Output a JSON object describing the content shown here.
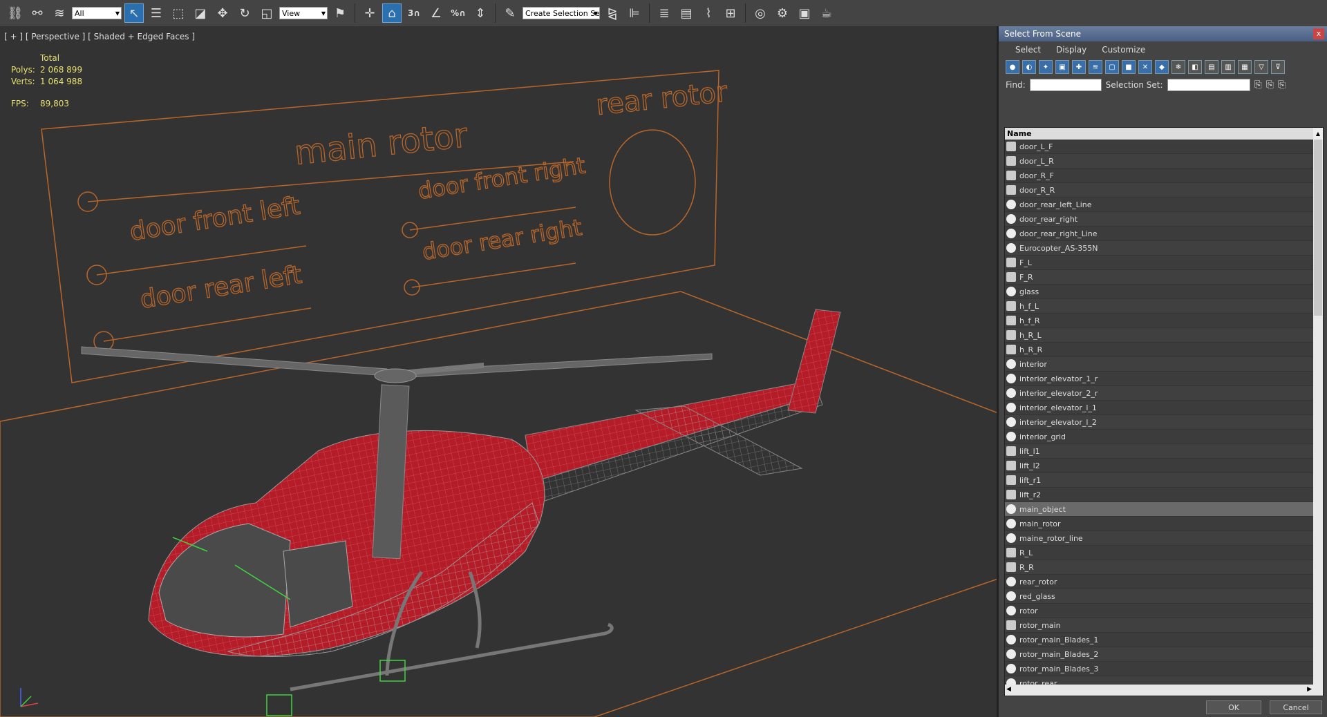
{
  "toolbar": {
    "filter_value": "All",
    "refcoord_value": "View",
    "named_selection_value": "Create Selection Se",
    "snap_label": "3",
    "percent_label": "%"
  },
  "viewport": {
    "label": "[ + ] [ Perspective ] [ Shaded + Edged Faces ]",
    "stats": {
      "total_label": "Total",
      "polys_label": "Polys:",
      "polys_value": "2 068 899",
      "verts_label": "Verts:",
      "verts_value": "1 064 988",
      "fps_label": "FPS:",
      "fps_value": "89,803"
    },
    "scene_texts": {
      "main_rotor": "main rotor",
      "rear_rotor": "rear rotor",
      "door_front_left": "door front left",
      "door_front_right": "door front right",
      "door_rear_left": "door rear left",
      "door_rear_right": "door rear right"
    },
    "colors": {
      "helper": "#b8662a",
      "fuselage": "#b41c28",
      "wire": "#9a9a9a"
    }
  },
  "dialog": {
    "title": "Select From Scene",
    "close": "x",
    "menu": [
      "Select",
      "Display",
      "Customize"
    ],
    "find_label": "Find:",
    "selection_set_label": "Selection Set:",
    "list_header": "Name",
    "items": [
      {
        "name": "door_L_F",
        "icon": "shape-icon"
      },
      {
        "name": "door_L_R",
        "icon": "shape-icon"
      },
      {
        "name": "door_R_F",
        "icon": "shape-icon"
      },
      {
        "name": "door_R_R",
        "icon": "shape-icon"
      },
      {
        "name": "door_rear_left_Line",
        "icon": "geometry-icon"
      },
      {
        "name": "door_rear_right",
        "icon": "geometry-icon"
      },
      {
        "name": "door_rear_right_Line",
        "icon": "geometry-icon"
      },
      {
        "name": "Eurocopter_AS-355N",
        "icon": "geometry-icon"
      },
      {
        "name": "F_L",
        "icon": "shape-icon"
      },
      {
        "name": "F_R",
        "icon": "shape-icon"
      },
      {
        "name": "glass",
        "icon": "geometry-icon"
      },
      {
        "name": "h_f_L",
        "icon": "shape-icon"
      },
      {
        "name": "h_f_R",
        "icon": "shape-icon"
      },
      {
        "name": "h_R_L",
        "icon": "shape-icon"
      },
      {
        "name": "h_R_R",
        "icon": "shape-icon"
      },
      {
        "name": "interior",
        "icon": "geometry-icon"
      },
      {
        "name": "interior_elevator_1_r",
        "icon": "geometry-icon"
      },
      {
        "name": "interior_elevator_2_r",
        "icon": "geometry-icon"
      },
      {
        "name": "interior_elevator_l_1",
        "icon": "geometry-icon"
      },
      {
        "name": "interior_elevator_l_2",
        "icon": "geometry-icon"
      },
      {
        "name": "interior_grid",
        "icon": "geometry-icon"
      },
      {
        "name": "lift_l1",
        "icon": "shape-icon"
      },
      {
        "name": "lift_l2",
        "icon": "shape-icon"
      },
      {
        "name": "lift_r1",
        "icon": "shape-icon"
      },
      {
        "name": "lift_r2",
        "icon": "shape-icon"
      },
      {
        "name": "main_object",
        "icon": "geometry-icon",
        "selected": true
      },
      {
        "name": "main_rotor",
        "icon": "geometry-icon"
      },
      {
        "name": "maine_rotor_line",
        "icon": "geometry-icon"
      },
      {
        "name": "R_L",
        "icon": "shape-icon"
      },
      {
        "name": "R_R",
        "icon": "shape-icon"
      },
      {
        "name": "rear_rotor",
        "icon": "geometry-icon"
      },
      {
        "name": "red_glass",
        "icon": "geometry-icon"
      },
      {
        "name": "rotor",
        "icon": "geometry-icon"
      },
      {
        "name": "rotor_main",
        "icon": "shape-icon"
      },
      {
        "name": "rotor_main_Blades_1",
        "icon": "geometry-icon"
      },
      {
        "name": "rotor_main_Blades_2",
        "icon": "geometry-icon"
      },
      {
        "name": "rotor_main_Blades_3",
        "icon": "geometry-icon"
      },
      {
        "name": "rotor_rear",
        "icon": "geometry-icon"
      }
    ],
    "ok_label": "OK",
    "cancel_label": "Cancel"
  }
}
